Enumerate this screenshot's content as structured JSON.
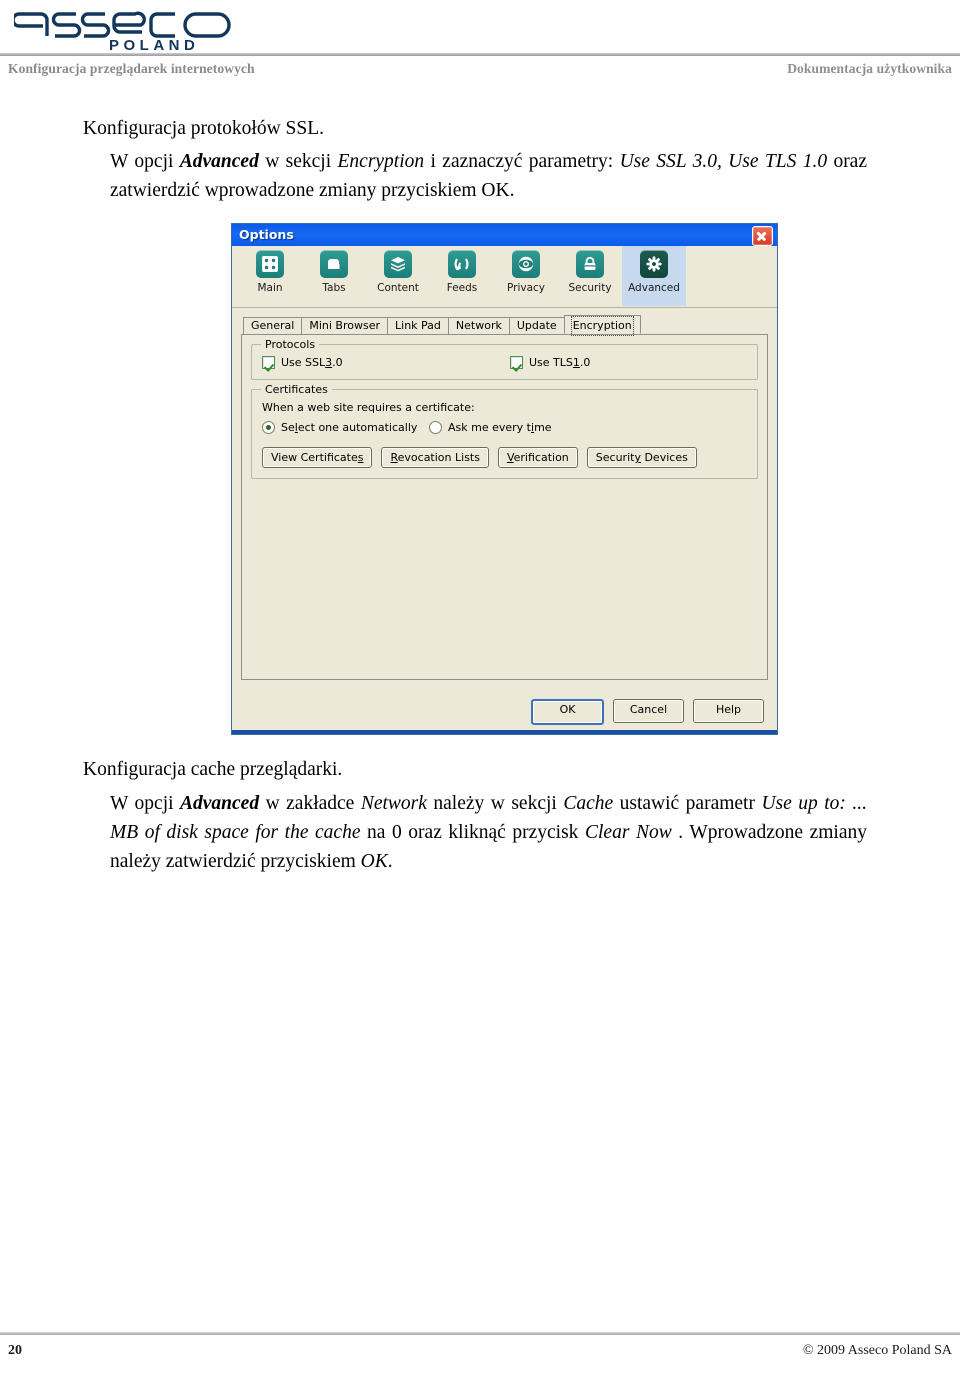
{
  "header": {
    "logo_main": "asseco",
    "logo_sub": "POLAND",
    "left_text": "Konfiguracja przeglądarek internetowych",
    "right_text": "Dokumentacja użytkownika"
  },
  "body": {
    "section1_title": "Konfiguracja protokołów SSL.",
    "section1_paragraph_plain": "W opcji Advanced w sekcji Encryption i zaznaczyć parametry: Use SSL 3.0, Use TLS 1.0 oraz zatwierdzić wprowadzone zmiany przyciskiem OK.",
    "section1_parts": {
      "t1": "W opcji ",
      "b1": "Advanced",
      "t2": " w sekcji ",
      "i1": "Encryption",
      "t3": " i zaznaczyć parametry: ",
      "i2": "Use SSL 3.0, Use TLS 1.0",
      "t4": " oraz zatwierdzić wprowadzone zmiany przyciskiem OK."
    },
    "section2_title": "Konfiguracja cache przeglądarki.",
    "section2_paragraph_plain": "W opcji Advanced w zakładce Network należy w sekcji Cache ustawić parametr Use up to: ... MB of disk space for the cache na 0 oraz kliknąć przycisk Clear Now . Wprowadzone zmiany należy zatwierdzić przyciskiem OK.",
    "section2_parts": {
      "t1": "W opcji ",
      "b1": "Advanced",
      "t2": " w zakładce ",
      "i1": "Network",
      "t3": " należy w sekcji  ",
      "i2": "Cache",
      "t4": " ustawić parametr ",
      "i3": "Use up to: ... MB of disk space for the  cache",
      "t5": " na 0 oraz kliknąć przycisk ",
      "i4": "Clear Now",
      "t6": " . Wprowadzone zmiany należy  zatwierdzić przyciskiem ",
      "i5": "OK",
      "t7": "."
    }
  },
  "dialog": {
    "title": "Options",
    "close_label": "Close",
    "toolbar": [
      {
        "label": "Main",
        "icon": "grid-icon",
        "selected": false
      },
      {
        "label": "Tabs",
        "icon": "tabs-icon",
        "selected": false
      },
      {
        "label": "Content",
        "icon": "stack-icon",
        "selected": false
      },
      {
        "label": "Feeds",
        "icon": "rss-icon",
        "selected": false
      },
      {
        "label": "Privacy",
        "icon": "eye-icon",
        "selected": false
      },
      {
        "label": "Security",
        "icon": "lock-icon",
        "selected": false
      },
      {
        "label": "Advanced",
        "icon": "gear-icon",
        "selected": true
      }
    ],
    "tabs": [
      {
        "label": "General",
        "active": false
      },
      {
        "label": "Mini Browser",
        "active": false
      },
      {
        "label": "Link Pad",
        "active": false
      },
      {
        "label": "Network",
        "active": false
      },
      {
        "label": "Update",
        "active": false
      },
      {
        "label": "Encryption",
        "active": true
      }
    ],
    "protocols": {
      "group_title": "Protocols",
      "ssl": {
        "label_a": "Use SSL ",
        "label_mn": "3",
        "label_b": ".0",
        "checked": true
      },
      "tls": {
        "label_a": "Use TLS ",
        "label_mn": "1",
        "label_b": ".0",
        "checked": true
      }
    },
    "certificates": {
      "group_title": "Certificates",
      "prompt": "When a web site requires a certificate:",
      "radio_auto": {
        "label_a": "Se",
        "label_mn": "l",
        "label_b": "ect one automatically",
        "selected": true
      },
      "radio_ask": {
        "label_a": "Ask me every t",
        "label_mn": "i",
        "label_b": "me",
        "selected": false
      },
      "buttons": [
        {
          "label_a": "View Certificate",
          "label_mn": "s",
          "label_b": ""
        },
        {
          "label_a": "",
          "label_mn": "R",
          "label_b": "evocation Lists"
        },
        {
          "label_a": "",
          "label_mn": "V",
          "label_b": "erification"
        },
        {
          "label_a": "Securit",
          "label_mn": "y",
          "label_b": " Devices"
        }
      ]
    },
    "buttons": [
      {
        "label": "OK",
        "default": true
      },
      {
        "label": "Cancel",
        "default": false
      },
      {
        "label": "Help",
        "default": false
      }
    ]
  },
  "footer": {
    "page_number": "20",
    "copyright": "© 2009 Asseco Poland SA"
  },
  "colors": {
    "titlebar_blue": "#0f60ef",
    "close_red": "#d43b21",
    "icon_teal": "#1d7d78",
    "icon_selected": "#10473c",
    "dialog_face": "#ece9d8",
    "selected_tab_bg": "#c7d9ef",
    "logo_navy": "#13375c",
    "header_grey": "#8a8a8a"
  }
}
